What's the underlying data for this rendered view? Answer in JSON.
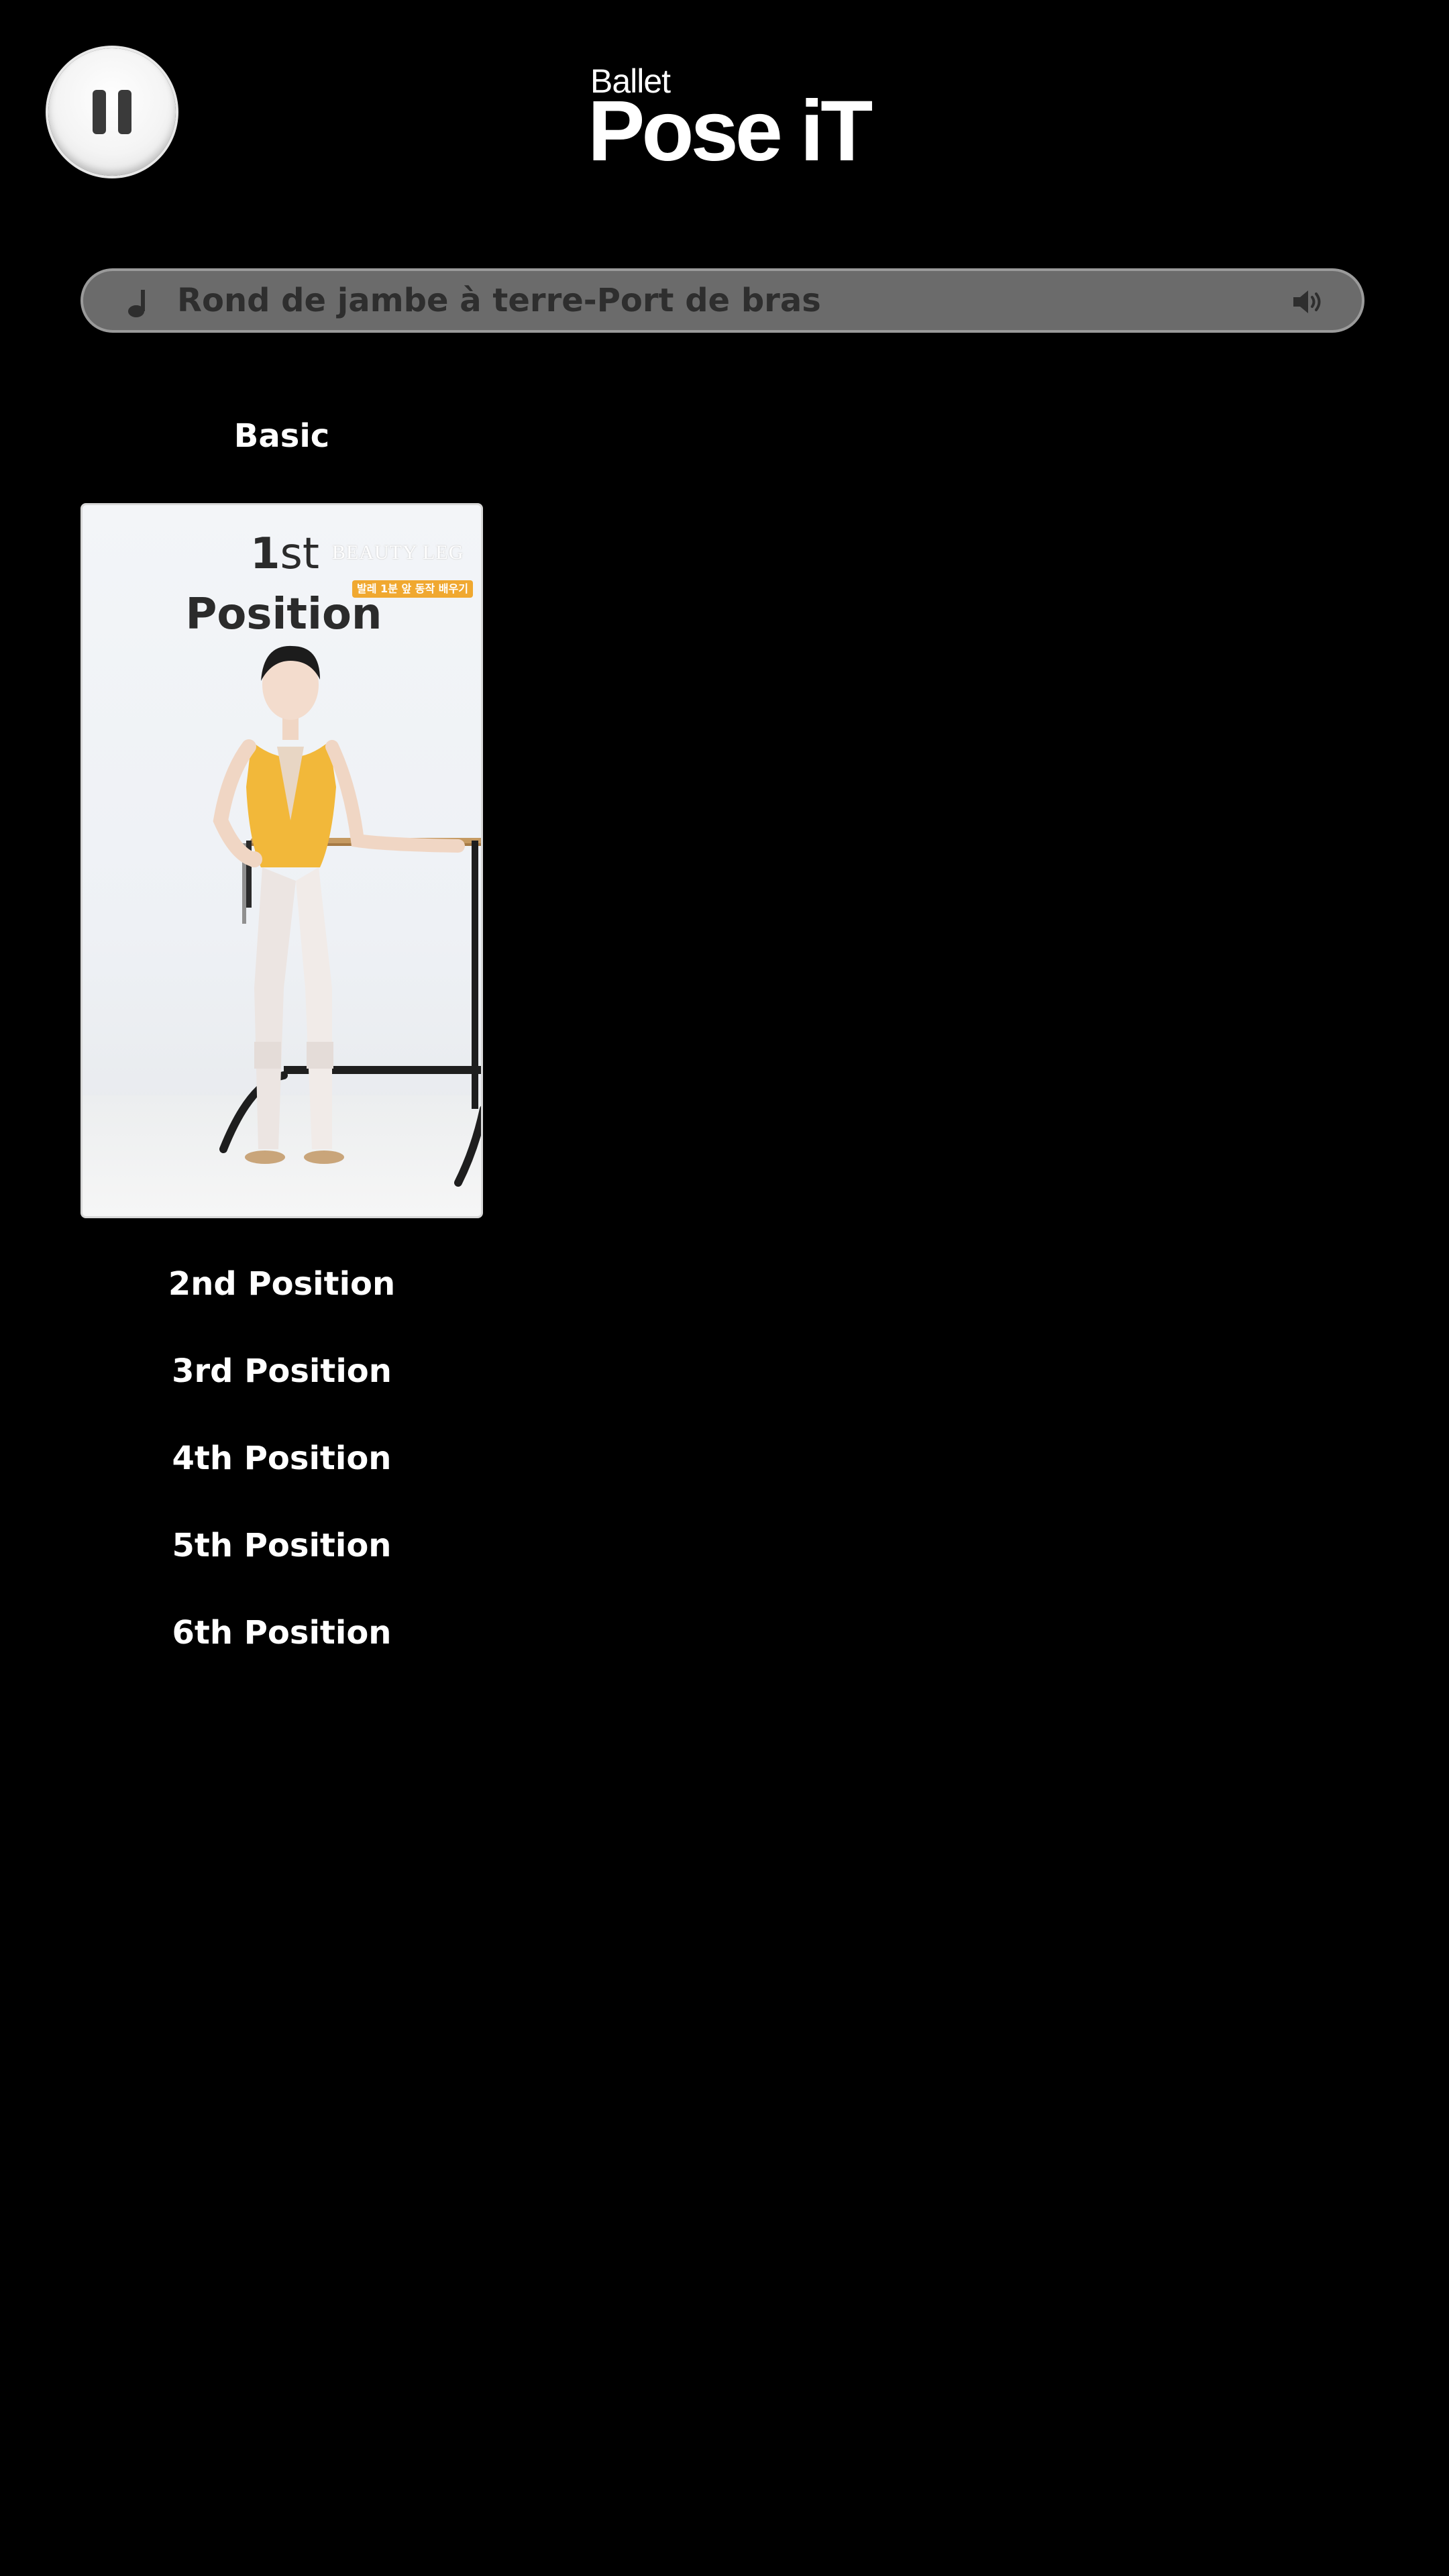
{
  "app": {
    "logo_small": "Ballet",
    "logo_big": "Pose iT"
  },
  "player": {
    "pause_icon": "pause-icon",
    "music_icon": "music-note-icon",
    "track_title": "Rond de jambe à terre-Port de bras",
    "volume_icon": "volume-icon"
  },
  "category": {
    "label": "Basic"
  },
  "featured": {
    "title_number": "1",
    "title_suffix": "st",
    "title_word": "Position",
    "badge_logo_text": "BEAUTY LEG",
    "badge_text": "발레 1분 앞 동작 배우기"
  },
  "positions": [
    {
      "label": "2nd Position"
    },
    {
      "label": "3rd Position"
    },
    {
      "label": "4th Position"
    },
    {
      "label": "5th Position"
    },
    {
      "label": "6th Position"
    }
  ],
  "colors": {
    "background": "#000000",
    "music_bar": "#6b6b6b",
    "leotard": "#f2b83a",
    "badge": "#f0a830"
  }
}
